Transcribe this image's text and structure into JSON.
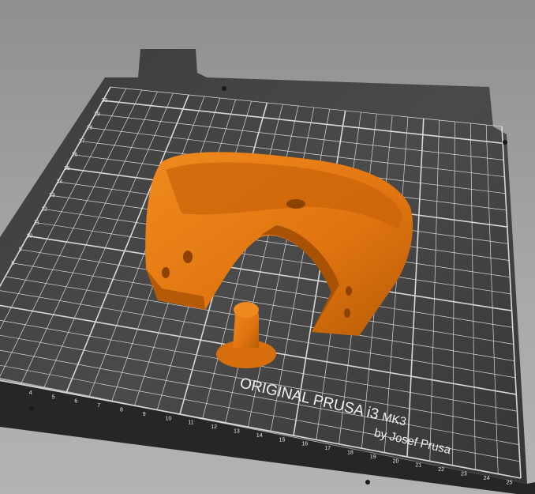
{
  "viewport": {
    "bed_logo": {
      "title": "ORIGINAL PRUSA i3",
      "model": "MK3",
      "subtitle": "by Josef Prusa"
    },
    "x_axis_labels": [
      "4",
      "5",
      "6",
      "7",
      "8",
      "9",
      "10",
      "11",
      "12",
      "13",
      "14",
      "15",
      "16",
      "17",
      "18",
      "19",
      "20",
      "21",
      "22",
      "23",
      "24",
      "25"
    ],
    "y_axis_labels": [
      "8",
      "9",
      "10",
      "11",
      "12",
      "13",
      "14",
      "15",
      "16",
      "17",
      "18",
      "19",
      "20"
    ],
    "colors": {
      "background": "#a6a6a6",
      "bed": "#3a3a3a",
      "grid": "#d8d8d8",
      "object": "#e47a10",
      "object_shadow": "#a85200"
    }
  }
}
